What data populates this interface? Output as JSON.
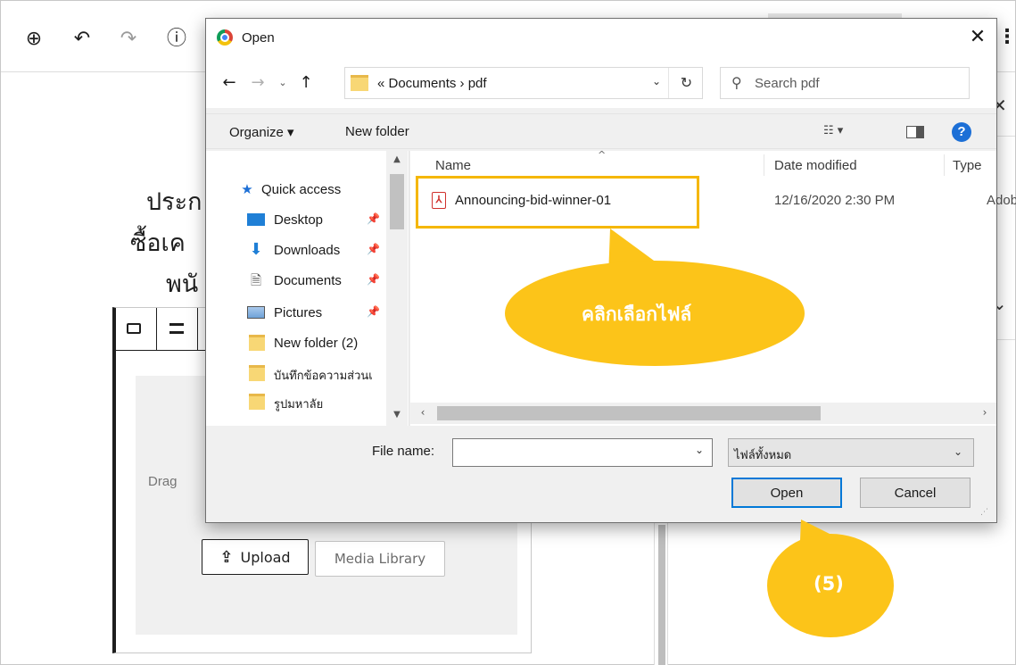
{
  "page": {
    "title_lines": [
      "ประก",
      "ซื้อเค",
      "พนั"
    ],
    "file_block": {
      "drag_text": "Drag",
      "upload_label": "Upload",
      "media_library_label": "Media Library"
    }
  },
  "dialog": {
    "title": "Open",
    "close_glyph": "✕",
    "address": {
      "path": "«  Documents  ›  pdf"
    },
    "search": {
      "placeholder": "Search pdf"
    },
    "commands": {
      "organize": "Organize ▾",
      "new_folder": "New folder",
      "help": "?"
    },
    "nav_items": [
      {
        "label": "Quick access",
        "icon": "star-icon",
        "pinned": false
      },
      {
        "label": "Desktop",
        "icon": "desktop-icon",
        "pinned": true
      },
      {
        "label": "Downloads",
        "icon": "download-icon",
        "pinned": true
      },
      {
        "label": "Documents",
        "icon": "document-icon",
        "pinned": true
      },
      {
        "label": "Pictures",
        "icon": "pictures-icon",
        "pinned": true
      },
      {
        "label": "New folder (2)",
        "icon": "folder-icon",
        "pinned": false
      },
      {
        "label": "บันทึกข้อความส่วนเ",
        "icon": "folder-icon",
        "pinned": false
      },
      {
        "label": "รูปมหาลัย",
        "icon": "folder-icon",
        "pinned": false
      }
    ],
    "columns": {
      "name": "Name",
      "date_modified": "Date modified",
      "type": "Type"
    },
    "files": [
      {
        "name": "Announcing-bid-winner-01",
        "date_modified": "12/16/2020 2:30 PM",
        "type": "Adob",
        "icon": "pdf-icon"
      }
    ],
    "file_name_label": "File name:",
    "file_name_value": "",
    "filter_value": "ไฟล์ทั้งหมด",
    "open_label": "Open",
    "cancel_label": "Cancel"
  },
  "annotations": {
    "select_file_text": "คลิกเลือกไฟล์",
    "step_text": "(5)",
    "accent_color": "#fcc419"
  }
}
